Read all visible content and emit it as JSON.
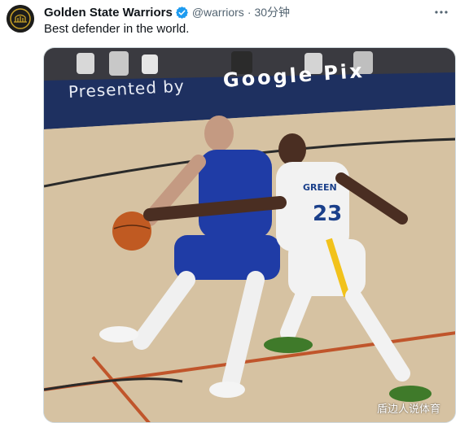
{
  "tweet": {
    "author_name": "Golden State Warriors",
    "handle": "@warriors",
    "separator": "·",
    "time": "30分钟",
    "text": "Best defender in the world.",
    "verified": true
  },
  "media": {
    "board_text": "Presented by",
    "board_brand": "Google Pix",
    "jersey_name": "GREEN",
    "jersey_number": "23",
    "watermark": "盾边人说体育"
  },
  "colors": {
    "name_text": "#0f1419",
    "secondary_text": "#536471",
    "verified_blue": "#1d9bf0",
    "border": "#cfd9de"
  },
  "icons": [
    "avatar-logo-icon",
    "verified-badge-icon",
    "more-options-icon"
  ]
}
